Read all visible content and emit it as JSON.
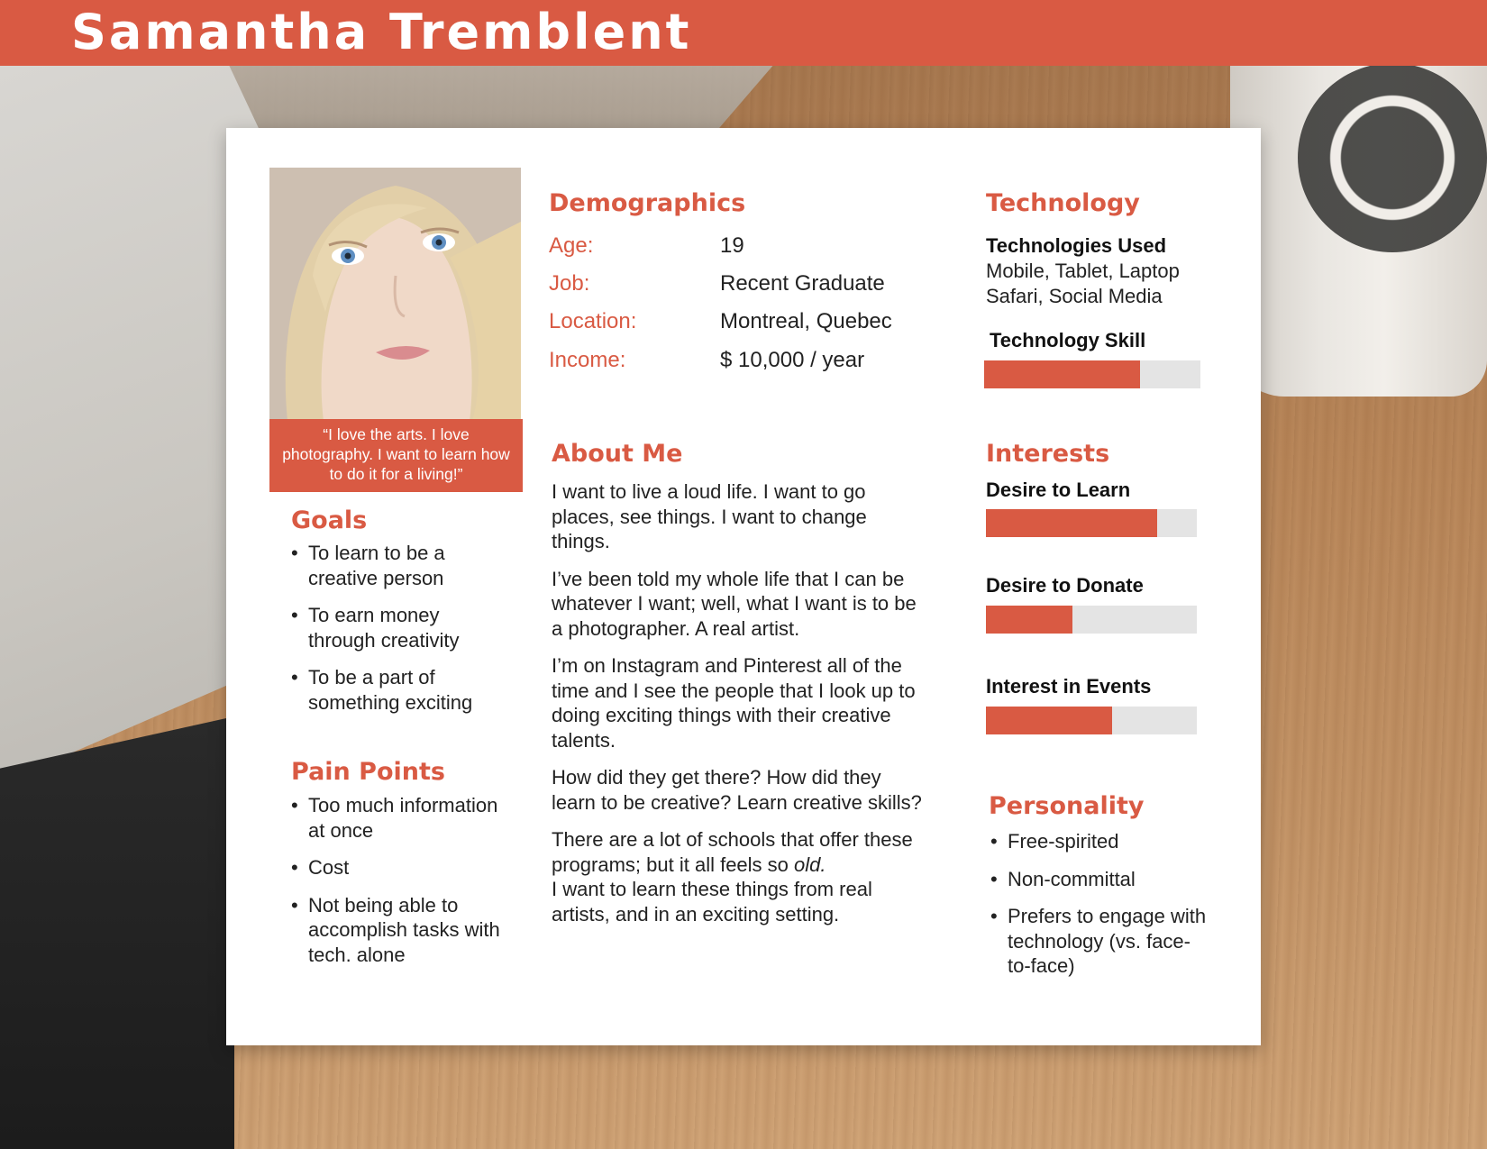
{
  "colors": {
    "accent": "#d95a43",
    "bar_track": "#e4e4e4"
  },
  "persona_name": "Samantha Tremblent",
  "photo_quote": "“I love the arts. I love photography. I want to learn how to do it for a living!”",
  "goals": {
    "title": "Goals",
    "items": [
      "To learn to be a creative person",
      "To earn money through creativity",
      "To be a part of something exciting"
    ]
  },
  "pain_points": {
    "title": "Pain Points",
    "items": [
      "Too much information at once",
      "Cost",
      "Not being able to accomplish tasks with tech. alone"
    ]
  },
  "demographics": {
    "title": "Demographics",
    "rows": [
      {
        "label": "Age:",
        "value": "19"
      },
      {
        "label": "Job:",
        "value": "Recent Graduate"
      },
      {
        "label": "Location:",
        "value": "Montreal, Quebec"
      },
      {
        "label": "Income:",
        "value": "$ 10,000 / year"
      }
    ]
  },
  "about_me": {
    "title": "About Me",
    "paragraphs": [
      "I want to live a loud life. I want to go places, see things. I want to change things.",
      "I’ve been told my whole life that I can be whatever I want; well, what I want is to be a photographer. A real artist.",
      "I’m on Instagram and Pinterest all of the time and I see the people that I look up to doing exciting things with their creative talents.",
      "How did they get there? How did they learn to be creative? Learn creative skills?",
      "There are a lot of schools that offer these programs; but it all feels so",
      "old.",
      "I want to learn these things from real artists, and in an exciting setting."
    ]
  },
  "technology": {
    "title": "Technology",
    "used_label": "Technologies Used",
    "used_lines": [
      "Mobile, Tablet, Laptop",
      "Safari, Social Media"
    ],
    "skill_label": "Technology Skill",
    "skill_level": 0.72
  },
  "interests": {
    "title": "Interests",
    "items": [
      {
        "label": "Desire to Learn",
        "level": 0.81
      },
      {
        "label": "Desire to Donate",
        "level": 0.41
      },
      {
        "label": "Interest in Events",
        "level": 0.6
      }
    ]
  },
  "personality": {
    "title": "Personality",
    "items": [
      "Free-spirited",
      "Non-committal",
      "Prefers to engage with technology (vs. face-to-face)"
    ]
  }
}
